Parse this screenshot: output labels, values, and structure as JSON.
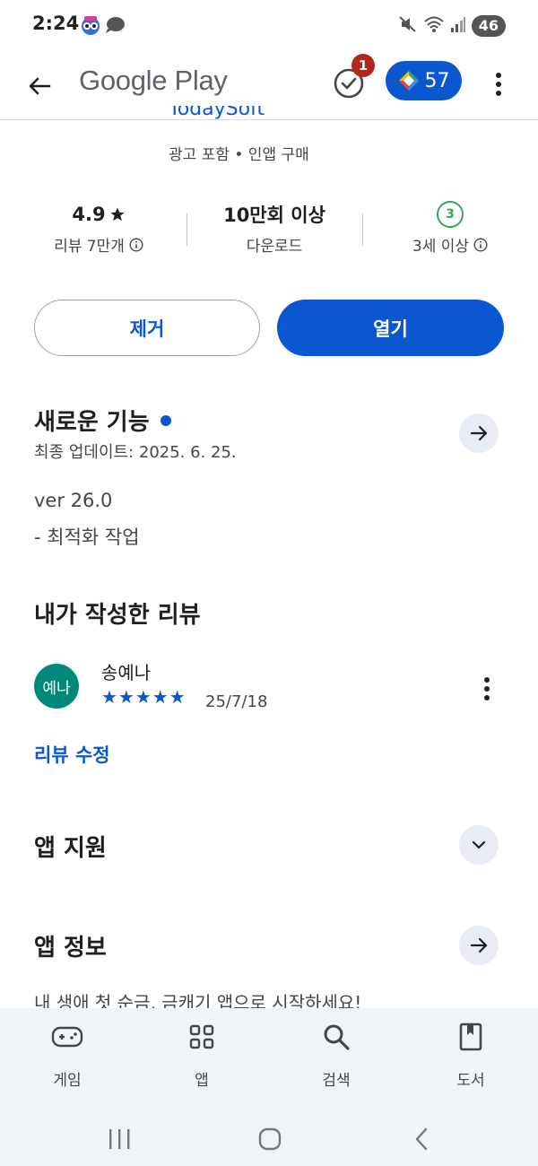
{
  "status_bar": {
    "time": "2:24",
    "battery": "46"
  },
  "app_bar": {
    "title": "Google Play",
    "tasks_badge": "1",
    "points": "57"
  },
  "app": {
    "developer": "TodaySoft",
    "meta": "광고 포함 • 인앱 구매"
  },
  "stats": {
    "rating": "4.9",
    "reviews_label": "리뷰 7만개",
    "downloads": "10만회 이상",
    "downloads_label": "다운로드",
    "age_rating": "3",
    "age_label": "3세 이상"
  },
  "buttons": {
    "uninstall": "제거",
    "open": "열기"
  },
  "whats_new": {
    "title": "새로운 기능",
    "updated": "최종 업데이트: 2025. 6. 25.",
    "version": "ver 26.0",
    "notes": "- 최적화 작업"
  },
  "my_review": {
    "title": "내가 작성한 리뷰",
    "avatar_text": "예나",
    "reviewer": "송예나",
    "stars": "★★★★★",
    "rating_value": 5,
    "date": "25/7/18",
    "edit_label": "리뷰 수정"
  },
  "app_support": {
    "title": "앱 지원"
  },
  "about": {
    "title": "앱 정보",
    "description": "내 생애 첫 순금, 금캐기 앱으로 시작하세요!"
  },
  "bottom_nav": {
    "items": [
      {
        "label": "게임",
        "icon": "gamepad-icon"
      },
      {
        "label": "앱",
        "icon": "apps-grid-icon"
      },
      {
        "label": "검색",
        "icon": "search-icon"
      },
      {
        "label": "도서",
        "icon": "book-icon"
      }
    ]
  },
  "colors": {
    "accent": "#0b57d0",
    "badge": "#b3261e",
    "age_green": "#34a853",
    "avatar_bg": "#00897b",
    "nav_bg": "#f0f4f9"
  }
}
